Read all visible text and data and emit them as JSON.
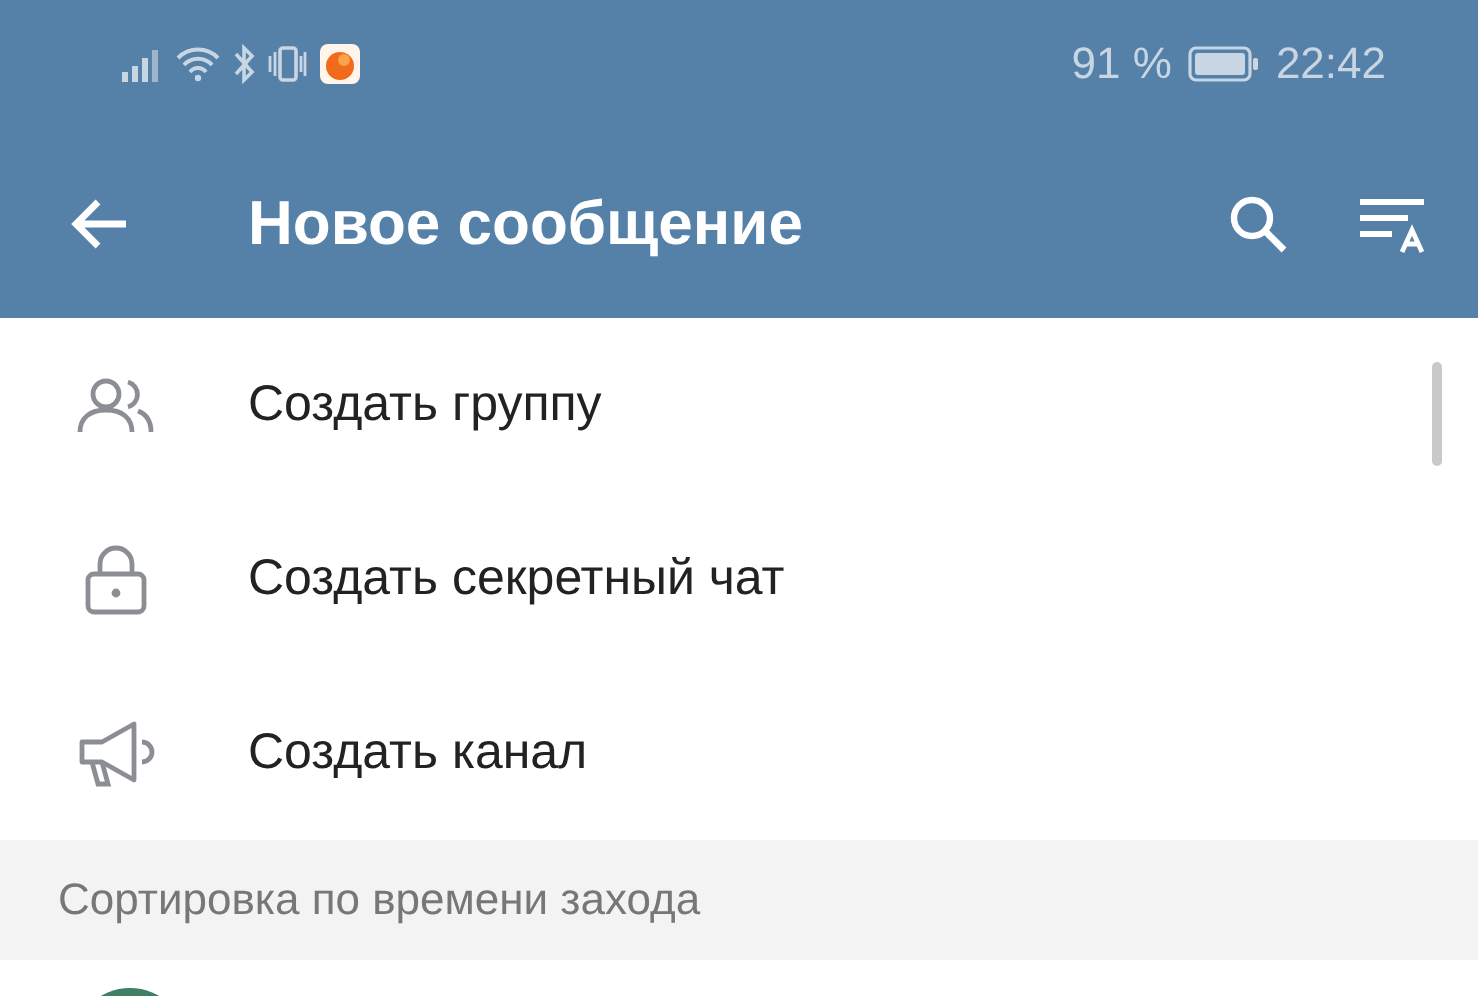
{
  "status_bar": {
    "battery_text": "91 %",
    "time": "22:42"
  },
  "header": {
    "title": "Новое сообщение"
  },
  "menu": [
    {
      "kind": "group",
      "label": "Создать группу"
    },
    {
      "kind": "lock",
      "label": "Создать секретный чат"
    },
    {
      "kind": "channel",
      "label": "Создать канал"
    }
  ],
  "section": {
    "title": "Сортировка по времени захода"
  }
}
